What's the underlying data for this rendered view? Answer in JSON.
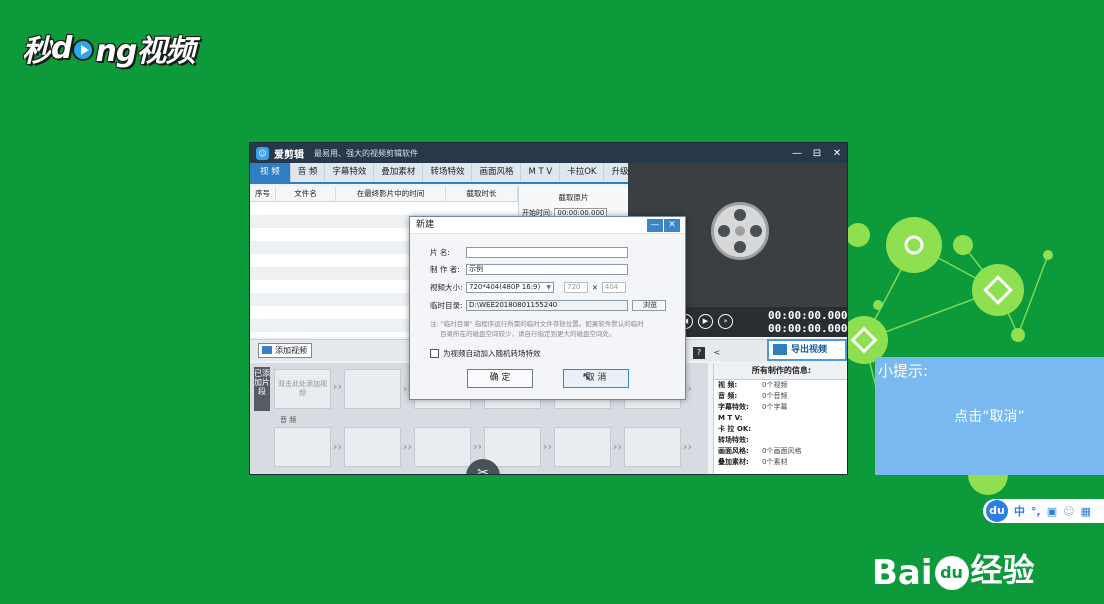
{
  "brand": {
    "text_a": "秒",
    "text_b": "d",
    "text_c": "ng视频"
  },
  "app": {
    "name": "爱剪辑",
    "slogan": "最易用、强大的视频剪辑软件",
    "window_buttons": [
      "—",
      "⊟",
      "✕"
    ]
  },
  "tabs": [
    {
      "label": "视 频",
      "active": true
    },
    {
      "label": "音 频",
      "active": false
    },
    {
      "label": "字幕特效",
      "active": false
    },
    {
      "label": "叠加素材",
      "active": false
    },
    {
      "label": "转场特效",
      "active": false
    },
    {
      "label": "画面风格",
      "active": false
    },
    {
      "label": "M T V",
      "active": false
    },
    {
      "label": "卡拉OK",
      "active": false
    },
    {
      "label": "升级与服务",
      "active": false
    }
  ],
  "table": {
    "columns": [
      "序号",
      "文件名",
      "在最终影片中的时间",
      "截取时长"
    ]
  },
  "clip_panel": {
    "title": "截取原片",
    "start_label": "开始时间:",
    "start_value": "00:00:00.000"
  },
  "preview": {
    "time_current": "00:00:00.000",
    "time_total": "00:00:00.000"
  },
  "toolbar": {
    "add_video": "添加视频",
    "export_video": "导出视频"
  },
  "timeline": {
    "side_label": "已添加片段",
    "first_slot": "双击此处添加视频",
    "audio_label": "音 频"
  },
  "info_panel": {
    "title": "所有制作的信息:",
    "rows": [
      {
        "k": "视  频:",
        "v": "0个视频"
      },
      {
        "k": "音  频:",
        "v": "0个音频"
      },
      {
        "k": "字幕特效:",
        "v": "0个字幕"
      },
      {
        "k": "M T V:",
        "v": ""
      },
      {
        "k": "卡 拉 OK:",
        "v": ""
      },
      {
        "k": "转场特效:",
        "v": ""
      },
      {
        "k": "画面风格:",
        "v": "0个画面风格"
      },
      {
        "k": "叠加素材:",
        "v": "0个素材"
      }
    ]
  },
  "dialog": {
    "title": "新建",
    "name_label": "片    名:",
    "name_value": "",
    "author_label": "制 作 者:",
    "author_value": "示例",
    "size_label": "视频大小:",
    "size_value": "720*404(480P 16:9)",
    "width_value": "720",
    "times": "✕",
    "height_value": "404",
    "temp_label": "临时目录:",
    "temp_value": "D:\\WEE20180801155240",
    "browse": "浏览",
    "note_line1": "注: \"临时目录\" 指程序运行所需的临时文件存放位置。如果软件默认的临时",
    "note_line2": "目录所在的磁盘空间较少，请自行指定到更大的磁盘空间处。",
    "checkbox_label": "为视频自动加入随机转场特效",
    "ok": "确 定",
    "cancel": "取 消"
  },
  "tip": {
    "title": "小提示:",
    "message": "点击“取消”"
  },
  "baidu": {
    "du": "du",
    "items": [
      "中",
      "°,"
    ],
    "logo_bai": "Bai",
    "logo_paw": "du",
    "logo_jy": "经验"
  }
}
